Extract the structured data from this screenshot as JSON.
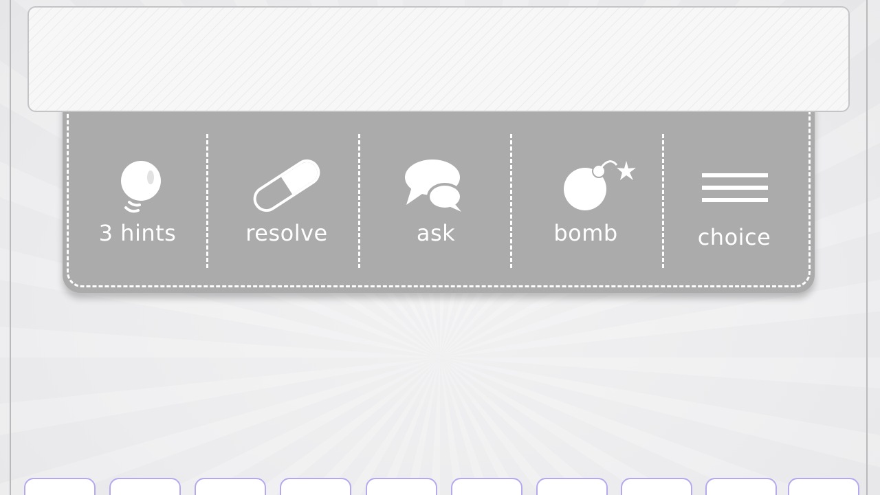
{
  "toolbar": {
    "hints": {
      "label": "3 hints",
      "icon": "lightbulb-icon"
    },
    "resolve": {
      "label": "resolve",
      "icon": "pill-icon"
    },
    "ask": {
      "label": "ask",
      "icon": "speech-bubbles-icon"
    },
    "bomb": {
      "label": "bomb",
      "icon": "bomb-icon"
    },
    "choice": {
      "label": "choice",
      "icon": "menu-lines-icon"
    }
  },
  "colors": {
    "toolbar_bg": "#ababab",
    "stitch": "#ffffff",
    "tile_border": "#b4a9ee",
    "background": "#ececee"
  },
  "letter_tiles": {
    "count": 10
  }
}
